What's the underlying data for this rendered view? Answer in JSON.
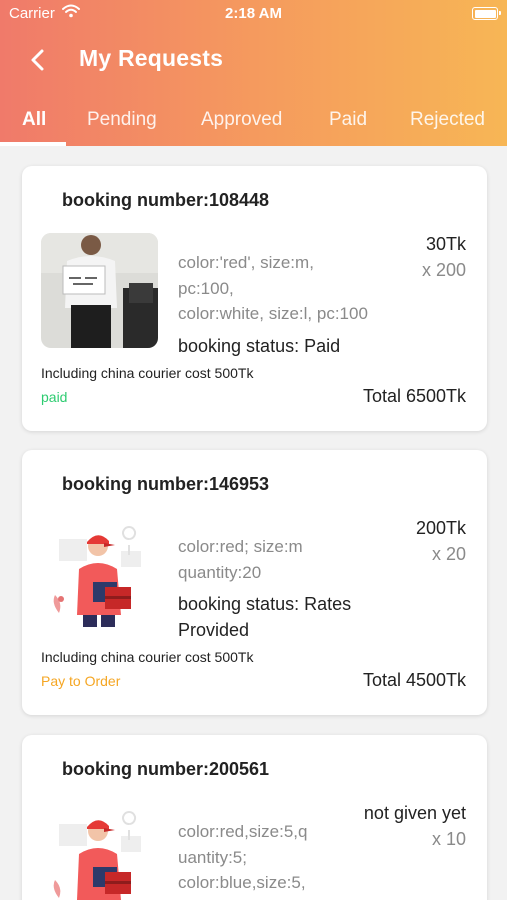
{
  "status_bar": {
    "carrier": "Carrier",
    "time": "2:18 AM"
  },
  "header": {
    "title": "My Requests"
  },
  "tabs": [
    "All",
    "Pending",
    "Approved",
    "Paid",
    "Rejected"
  ],
  "colors": {
    "gradient_start": "#f07a6a",
    "gradient_end": "#f7b655",
    "paid": "#2ecc71",
    "pay_to_order": "#f5a623"
  },
  "requests": [
    {
      "booking": "booking number:108448",
      "image": "product-photo",
      "specs": [
        "color:'red', size:m,",
        "pc:100,",
        "color:white, size:l, pc:100"
      ],
      "status": "booking status: Paid",
      "price": "30Tk",
      "qty": "x 200",
      "courier": "Including china courier cost 500Tk",
      "pay_state": "paid",
      "total": "Total 6500Tk"
    },
    {
      "booking": "booking number:146953",
      "image": "delivery-illustration",
      "specs": [
        "color:red; size:m",
        "quantity:20"
      ],
      "status": "booking status: Rates Provided",
      "price": "200Tk",
      "qty": "x 20",
      "courier": "Including china courier cost 500Tk",
      "pay_state": "Pay to Order",
      "total": "Total 4500Tk"
    },
    {
      "booking": "booking number:200561",
      "image": "delivery-illustration",
      "specs": [
        "color:red,size:5,q",
        "uantity:5;",
        "color:blue,size:5,"
      ],
      "price": "not given yet",
      "qty": "x 10"
    }
  ]
}
